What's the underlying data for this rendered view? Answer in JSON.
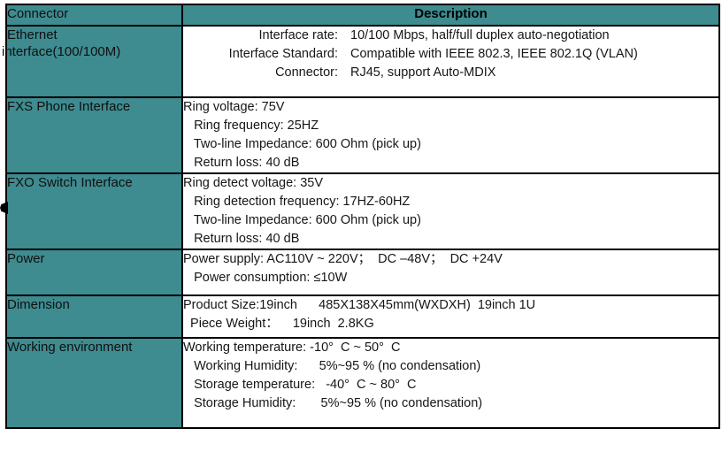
{
  "table": {
    "header": {
      "connector": "Connector",
      "description": "Description"
    },
    "rows": [
      {
        "label_lines": [
          "Ethernet",
          "interface(100/100M)"
        ],
        "style": "kv",
        "pairs": [
          {
            "key": "Interface rate:",
            "value": "10/100 Mbps,  half/full duplex auto-negotiation"
          },
          {
            "key": "Interface Standard:",
            "value": "Compatible with IEEE 802.3, IEEE 802.1Q (VLAN)"
          },
          {
            "key": "Connector:",
            "value": "RJ45, support Auto-MDIX"
          }
        ]
      },
      {
        "label_lines": [
          "FXS Phone Interface"
        ],
        "style": "lines",
        "lines": [
          "Ring voltage: 75V",
          "   Ring frequency: 25HZ",
          "   Two-line Impedance: 600 Ohm (pick up)",
          "   Return loss: 40 dB"
        ]
      },
      {
        "label_lines": [
          "FXO Switch Interface"
        ],
        "style": "lines",
        "lines": [
          "Ring detect voltage: 35V",
          "   Ring detection frequency: 17HZ-60HZ",
          "   Two-line Impedance: 600 Ohm (pick up)",
          "   Return loss: 40 dB"
        ]
      },
      {
        "label_lines": [
          "Power"
        ],
        "style": "lines",
        "lines": [
          "Power supply: AC110V ~ 220V；  DC –48V；  DC +24V",
          "   Power consumption: ≤10W"
        ]
      },
      {
        "label_lines": [
          "Dimension"
        ],
        "style": "lines",
        "lines": [
          "Product Size:19inch      485X138X45mm(WXDXH)  19inch 1U",
          "  Piece Weight：    19inch  2.8KG"
        ]
      },
      {
        "label_lines": [
          "Working environment"
        ],
        "style": "lines",
        "lines": [
          "Working temperature: -10°  C ~ 50°  C",
          "   Working Humidity:      5%~95 % (no condensation)",
          "   Storage temperature:   -40°  C ~ 80°  C",
          "   Storage Humidity:       5%~95 % (no condensation)"
        ]
      }
    ]
  },
  "colors": {
    "label_background": "#3E8B90",
    "border": "#000000",
    "text": "#161616",
    "page_background": "#FFFFFF"
  },
  "markers": {
    "left_edge_handle": "resize-handle"
  }
}
